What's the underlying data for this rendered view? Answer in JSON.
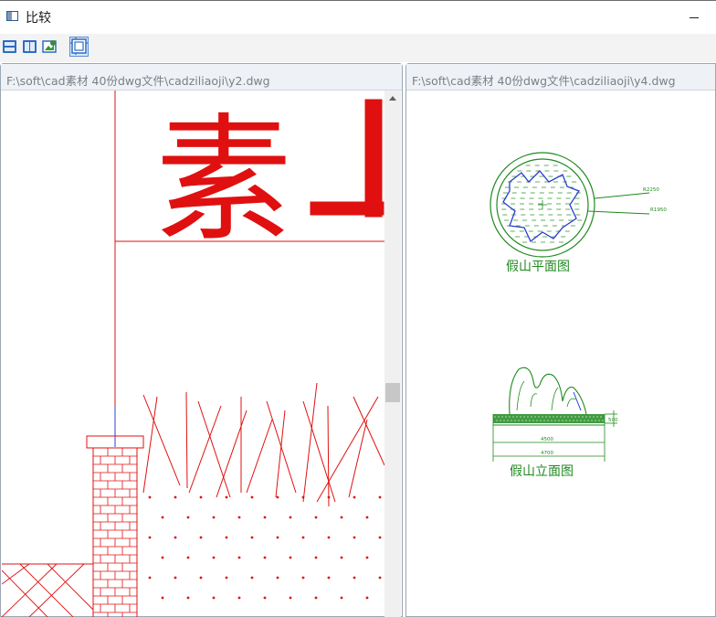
{
  "window": {
    "title": "比较",
    "app_icon": "compare-app-icon",
    "minimize_icon": "minimize-icon"
  },
  "toolbar": {
    "buttons": [
      {
        "name": "horizontal-split-icon",
        "selected": false
      },
      {
        "name": "vertical-split-icon",
        "selected": false
      },
      {
        "name": "compare-image-icon",
        "selected": false
      },
      {
        "name": "sync-view-icon",
        "selected": true
      }
    ]
  },
  "left_panel": {
    "title": "F:\\soft\\cad素材 40份dwg文件\\cadziliaoji\\y2.dwg"
  },
  "right_panel": {
    "title": "F:\\soft\\cad素材 40份dwg文件\\cadziliaoji\\y4.dwg",
    "drawing": {
      "plan_label": "假山平面图",
      "elevation_label": "假山立面图",
      "dim_r1": "R2250",
      "dim_r2": "R1950",
      "dim_w1": "4500",
      "dim_w2": "4700",
      "dim_h": "500"
    }
  },
  "left_drawing": {
    "big_char": "素"
  },
  "colors": {
    "cad_red": "#e01010",
    "cad_green": "#1f8a1f",
    "cad_blue": "#2a3fd0",
    "border": "#9aa7b3"
  }
}
